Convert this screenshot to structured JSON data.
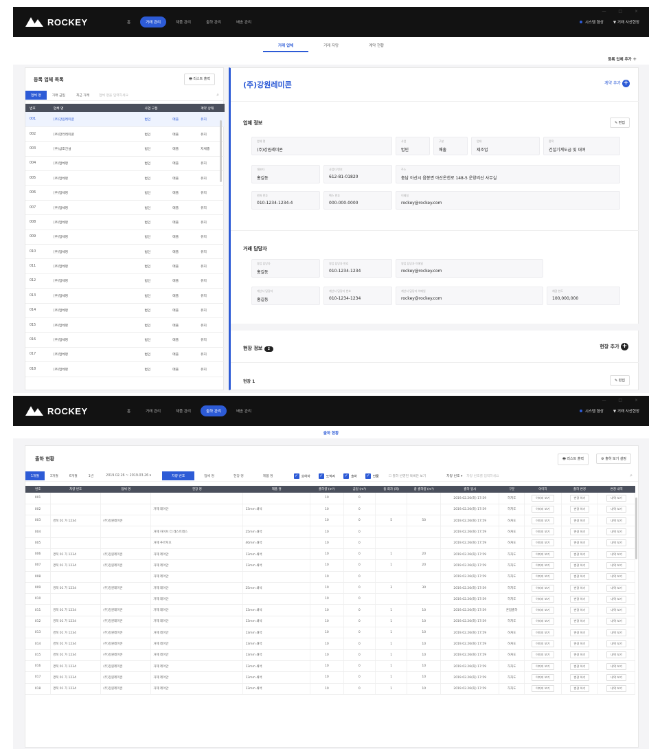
{
  "screen1": {
    "brand": "ROCKEY",
    "nav": [
      "홈",
      "거래 관리",
      "제품 관리",
      "출하 관리",
      "배송 관리"
    ],
    "nav_active_index": 1,
    "right": {
      "status": "시스템 형상",
      "user": "거래 사산현장"
    },
    "window_controls": "— □ ×",
    "tabs": [
      "거래 업체",
      "거래 자망",
      "계약 현황"
    ],
    "active_tab_index": 0,
    "add_company": "등록 업체 추가",
    "list": {
      "title": "등록 업체 목록",
      "print": "리스트 출력",
      "filters": [
        "업체 명",
        "거래 금일",
        "최근 거래"
      ],
      "search_placeholder": "업체 명을 입력하세요",
      "headers": [
        "번호",
        "업체 명",
        "사업 구분",
        "",
        "계약 상태"
      ],
      "rows": [
        [
          "001",
          "(주)강원레미콘",
          "법인",
          "매출",
          "유지"
        ],
        [
          "002",
          "(주)한라레미콘",
          "법인",
          "매출",
          "유지"
        ],
        [
          "003",
          "(주)삼호건설",
          "법인",
          "매출",
          "지체중"
        ],
        [
          "004",
          "(주)업체명",
          "법인",
          "매출",
          "유지"
        ],
        [
          "005",
          "(주)업체명",
          "법인",
          "매출",
          "유지"
        ],
        [
          "006",
          "(주)업체명",
          "법인",
          "매출",
          "유지"
        ],
        [
          "007",
          "(주)업체명",
          "법인",
          "매출",
          "유지"
        ],
        [
          "008",
          "(주)업체명",
          "법인",
          "매출",
          "유지"
        ],
        [
          "009",
          "(주)업체명",
          "법인",
          "매출",
          "유지"
        ],
        [
          "010",
          "(주)업체명",
          "법인",
          "매출",
          "유지"
        ],
        [
          "011",
          "(주)업체명",
          "법인",
          "매출",
          "유지"
        ],
        [
          "012",
          "(주)업체명",
          "법인",
          "매출",
          "유지"
        ],
        [
          "013",
          "(주)업체명",
          "법인",
          "매출",
          "유지"
        ],
        [
          "014",
          "(주)업체명",
          "법인",
          "매출",
          "유지"
        ],
        [
          "015",
          "(주)업체명",
          "법인",
          "매출",
          "유지"
        ],
        [
          "016",
          "(주)업체명",
          "법인",
          "매출",
          "유지"
        ],
        [
          "017",
          "(주)업체명",
          "법인",
          "매출",
          "유지"
        ],
        [
          "018",
          "(주)업체명",
          "법인",
          "매출",
          "유지"
        ]
      ]
    },
    "detail": {
      "company": "(주)강원레미콘",
      "add_contract": "계약 추가",
      "info_title": "업체 정보",
      "edit": "편집",
      "fields": {
        "name": {
          "label": "업체 명",
          "value": "(주)강원레미콘"
        },
        "biz": {
          "label": "사업",
          "value": "법인"
        },
        "type": {
          "label": "구분",
          "value": "매출"
        },
        "industry": {
          "label": "업태",
          "value": "제조업"
        },
        "item": {
          "label": "종목",
          "value": "건설기계도급 및 대여"
        },
        "ceo": {
          "label": "대표자",
          "value": "홍길동"
        },
        "biznum": {
          "label": "사업자 번호",
          "value": "612-81-01820"
        },
        "addr": {
          "label": "주소",
          "value": "충남 아산시 음봉면 아산온천로 148-5 운양리산 사무실"
        },
        "phone": {
          "label": "전화 번호",
          "value": "010-1234-1234-4"
        },
        "fax": {
          "label": "팩스 번호",
          "value": "000-000-0000"
        },
        "email": {
          "label": "이메일",
          "value": "rockey@rockey.com"
        }
      },
      "contact_title": "거래 담당자",
      "contacts": {
        "sales_name": {
          "label": "영업 담당자",
          "value": "홍길동"
        },
        "sales_phone": {
          "label": "영업 담당자 번호",
          "value": "010-1234-1234"
        },
        "sales_email": {
          "label": "영업 담당자 이메일",
          "value": "rockey@rockey.com"
        },
        "acct_name": {
          "label": "계산서 담당자",
          "value": "홍길동"
        },
        "acct_phone": {
          "label": "계산서 담당자 번호",
          "value": "010-1234-1234"
        },
        "acct_email": {
          "label": "계산서 담당자 이메일",
          "value": "rockey@rockey.com"
        },
        "credit": {
          "label": "채권 한도",
          "value": "100,000,000"
        }
      },
      "site_title": "현장 정보",
      "site_count": "2",
      "site_add": "현장 추가",
      "site1": "현장 1"
    }
  },
  "screen2": {
    "brand": "ROCKEY",
    "nav": [
      "홈",
      "거래 관리",
      "제품 관리",
      "출하 관리",
      "배송 관리"
    ],
    "nav_active_index": 3,
    "right": {
      "status": "시스템 형상",
      "user": "거래 사산현장"
    },
    "window_controls": "— □ ×",
    "tab": "출하 현황",
    "title": "출하 현황",
    "print": "리스트 출력",
    "settings": "출하 보기 설정",
    "periods": [
      "1개월",
      "3개월",
      "6개월",
      "1년"
    ],
    "date_range": "2019.02.26 ~ 2019.03.26",
    "view_modes": [
      "차량 번호",
      "업체 명",
      "현장 명",
      "제품 명"
    ],
    "checks": [
      "상하차",
      "도착지",
      "출하",
      "반품"
    ],
    "check_note": "출하 반영된 목록만 보기",
    "search_label": "차량 번호",
    "search_placeholder": "차량 번호를 입력하세요",
    "headers": [
      "번호",
      "차량 번호",
      "업체 명",
      "현장 명",
      "제품 명",
      "출하량 (m³)",
      "금일 (m³)",
      "총 회차 (회)",
      "총 출하량 (m³)",
      "출하 일시",
      "구분",
      "이미지",
      "출하 변경",
      "변경 내역"
    ],
    "rows": [
      [
        "001",
        "",
        "",
        "",
        "",
        "10",
        "0",
        "",
        "",
        "2019.02.26(화) 17:59",
        "하차도",
        "이미지 보기",
        "변경 하기",
        "내역 보기"
      ],
      [
        "002",
        "",
        "",
        "거제 레이안",
        "13mm 쇄석",
        "10",
        "0",
        "",
        "",
        "2019.02.26(화) 17:59",
        "하차도",
        "이미지 보기",
        "변경 하기",
        "내역 보기"
      ],
      [
        "003",
        "경북 01 가 1234",
        "(주)강원레미콘",
        "",
        "",
        "10",
        "0",
        "5",
        "50",
        "2019.02.26(화) 17:59",
        "하차도",
        "이미지 보기",
        "변경 하기",
        "내역 보기"
      ],
      [
        "004",
        "",
        "",
        "거제 하이브 더 레스트래스",
        "25mm 쇄석",
        "10",
        "0",
        "",
        "",
        "2019.02.26(화) 17:59",
        "하차도",
        "이미지 보기",
        "변경 하기",
        "내역 보기"
      ],
      [
        "005",
        "",
        "",
        "거제 푸르지오",
        "40mm 쇄석",
        "10",
        "0",
        "",
        "",
        "2019.02.26(화) 17:59",
        "하차도",
        "이미지 보기",
        "변경 하기",
        "내역 보기"
      ],
      [
        "006",
        "경북 01 가 1234",
        "(주)강원레미콘",
        "거제 레이안",
        "13mm 쇄석",
        "10",
        "0",
        "1",
        "20",
        "2019.02.26(화) 17:59",
        "하차도",
        "이미지 보기",
        "변경 하기",
        "내역 보기"
      ],
      [
        "007",
        "경북 01 가 1234",
        "(주)강원레미콘",
        "거제 레이안",
        "13mm 쇄석",
        "10",
        "0",
        "1",
        "20",
        "2019.02.26(화) 17:59",
        "하차도",
        "이미지 보기",
        "변경 하기",
        "내역 보기"
      ],
      [
        "008",
        "",
        "",
        "거제 레이안",
        "",
        "10",
        "0",
        "",
        "",
        "2019.02.26(화) 17:59",
        "하차도",
        "이미지 보기",
        "변경 하기",
        "내역 보기"
      ],
      [
        "009",
        "경북 01 가 1234",
        "(주)강원레미콘",
        "거제 레이안",
        "25mm 쇄석",
        "10",
        "0",
        "3",
        "30",
        "2019.02.26(화) 17:59",
        "하차도",
        "이미지 보기",
        "변경 하기",
        "내역 보기"
      ],
      [
        "010",
        "",
        "",
        "거제 레이안",
        "",
        "10",
        "0",
        "",
        "",
        "2019.02.26(화) 17:59",
        "하차도",
        "이미지 보기",
        "변경 하기",
        "내역 보기"
      ],
      [
        "011",
        "경북 01 가 1234",
        "(주)강원레미콘",
        "거제 레이안",
        "13mm 쇄석",
        "10",
        "0",
        "1",
        "10",
        "2019.02.26(화) 17:59",
        "혼합출하",
        "이미지 보기",
        "변경 하기",
        "내역 보기"
      ],
      [
        "012",
        "경북 01 가 1234",
        "(주)강원레미콘",
        "거제 레이안",
        "13mm 쇄석",
        "10",
        "0",
        "1",
        "10",
        "2019.02.26(화) 17:59",
        "하차도",
        "이미지 보기",
        "변경 하기",
        "내역 보기"
      ],
      [
        "013",
        "경북 01 가 1234",
        "(주)강원레미콘",
        "거제 레이안",
        "13mm 쇄석",
        "10",
        "0",
        "1",
        "10",
        "2019.02.26(화) 17:59",
        "하차도",
        "이미지 보기",
        "변경 하기",
        "내역 보기"
      ],
      [
        "014",
        "경북 01 가 1234",
        "(주)강원레미콘",
        "거제 레이안",
        "13mm 쇄석",
        "10",
        "0",
        "1",
        "10",
        "2019.02.26(화) 17:59",
        "하차도",
        "이미지 보기",
        "변경 하기",
        "내역 보기"
      ],
      [
        "015",
        "경북 01 가 1234",
        "(주)강원레미콘",
        "거제 레이안",
        "13mm 쇄석",
        "10",
        "0",
        "1",
        "10",
        "2019.02.26(화) 17:59",
        "하차도",
        "이미지 보기",
        "변경 하기",
        "내역 보기"
      ],
      [
        "016",
        "경북 01 가 1234",
        "(주)강원레미콘",
        "거제 레이안",
        "13mm 쇄석",
        "10",
        "0",
        "1",
        "10",
        "2019.02.26(화) 17:59",
        "하차도",
        "이미지 보기",
        "변경 하기",
        "내역 보기"
      ],
      [
        "017",
        "경북 01 가 1234",
        "(주)강원레미콘",
        "거제 레이안",
        "13mm 쇄석",
        "10",
        "0",
        "1",
        "10",
        "2019.02.26(화) 17:59",
        "하차도",
        "이미지 보기",
        "변경 하기",
        "내역 보기"
      ],
      [
        "018",
        "경북 01 가 1234",
        "(주)강원레미콘",
        "거제 레이안",
        "13mm 쇄석",
        "10",
        "0",
        "1",
        "10",
        "2019.02.26(화) 17:59",
        "하차도",
        "이미지 보기",
        "변경 하기",
        "내역 보기"
      ]
    ]
  },
  "colors": {
    "accent": "#2d5bd6",
    "topbar": "#121212",
    "header": "#4a4f5c"
  }
}
